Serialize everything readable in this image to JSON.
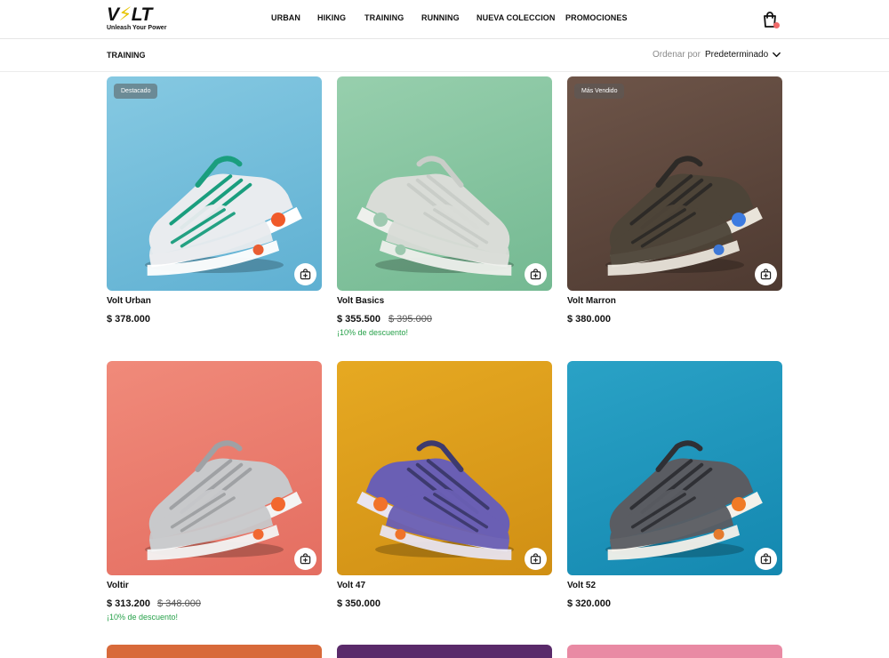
{
  "brand": {
    "name_prefix": "V",
    "name_bolt": "⚡",
    "name_suffix": "LT",
    "tagline": "Unleash Your Power"
  },
  "nav": [
    "URBAN",
    "HIKING",
    "TRAINING",
    "RUNNING",
    "NUEVA COLECCION",
    "PROMOCIONES"
  ],
  "breadcrumb": "TRAINING",
  "sort": {
    "label": "Ordenar por",
    "value": "Predeterminado"
  },
  "products": [
    {
      "name": "Volt Urban",
      "price": "$ 378.000",
      "old_price": "",
      "discount": "",
      "badge": "Destacado",
      "bg": [
        "#86c9e2",
        "#5fb0d2"
      ],
      "shoe": {
        "body": "#e9ecef",
        "accent": "#1a9e7e",
        "sole": "#ffffff",
        "pop": "#f05a2a"
      }
    },
    {
      "name": "Volt Basics",
      "price": "$ 355.500",
      "old_price": "$ 395.000",
      "discount": "¡10% de descuento!",
      "badge": "",
      "bg": [
        "#97cfad",
        "#74b992"
      ],
      "shoe": {
        "body": "#d9dcd7",
        "accent": "#c9cdc8",
        "sole": "#eef0ec",
        "pop": "#9ec9b0"
      }
    },
    {
      "name": "Volt Marron",
      "price": "$ 380.000",
      "old_price": "",
      "discount": "",
      "badge": "Más Vendido",
      "bg": [
        "#6e5549",
        "#4e3a31"
      ],
      "shoe": {
        "body": "#4d4438",
        "accent": "#2d2a27",
        "sole": "#e9e4da",
        "pop": "#3d7be0"
      }
    },
    {
      "name": "Voltir",
      "price": "$ 313.200",
      "old_price": "$ 348.000",
      "discount": "¡10% de descuento!",
      "badge": "",
      "bg": [
        "#f08a7a",
        "#e46e61"
      ],
      "shoe": {
        "body": "#c8c9cb",
        "accent": "#9fa1a4",
        "sole": "#f4f4f4",
        "pop": "#f2682e"
      }
    },
    {
      "name": "Volt 47",
      "price": "$ 350.000",
      "old_price": "",
      "discount": "",
      "badge": "",
      "bg": [
        "#e6a922",
        "#d08f14"
      ],
      "shoe": {
        "body": "#6a5fb4",
        "accent": "#3d3a6e",
        "sole": "#e9e4ef",
        "pop": "#f1722a"
      }
    },
    {
      "name": "Volt 52",
      "price": "$ 320.000",
      "old_price": "",
      "discount": "",
      "badge": "",
      "bg": [
        "#2aa2c6",
        "#1488b0"
      ],
      "shoe": {
        "body": "#5a5c62",
        "accent": "#2f3035",
        "sole": "#f4f1ea",
        "pop": "#f07a26"
      }
    }
  ],
  "next_row_colors": [
    "#d86a3a",
    "#5a2a6a",
    "#e98aa4"
  ],
  "colors": {
    "discount_green": "#27a14a",
    "cart_dot": "#f06a6a"
  }
}
